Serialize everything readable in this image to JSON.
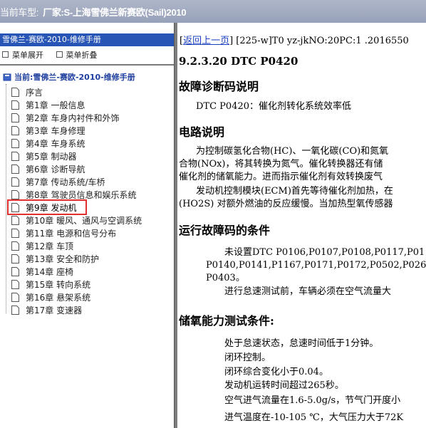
{
  "topbar": {
    "label": "当前车型:",
    "value": "厂家:S-上海雪佛兰新赛欧(Sail)2010"
  },
  "left": {
    "header": "雪佛兰-赛欧-2010-维修手册",
    "expand": "菜单展开",
    "collapse": "菜单折叠",
    "root": "当前:雪佛兰-赛欧-2010-维修手册",
    "items": [
      "序言",
      "第1章 一般信息",
      "第2章 车身内衬件和外饰",
      "第3章 车身修理",
      "第4章 车身系统",
      "第5章 制动器",
      "第6章 诊断导航",
      "第7章 传动系统/车桥",
      "第8章 驾驶员信息和娱乐系统",
      "第9章 发动机",
      "第10章 暖风、通风与空调系统",
      "第11章 电源和信号分布",
      "第12章 车顶",
      "第13章 安全和防护",
      "第14章 座椅",
      "第15章 转向系统",
      "第16章 悬架系统",
      "第17章 变速器"
    ]
  },
  "right": {
    "nav_open": "[",
    "nav_link": "返回上一页",
    "nav_rest": "] [225-w]T0 yz-jkNO:20PC:1 .2016550",
    "title": "9.2.3.20 DTC P0420",
    "sec1": "故障诊断码说明",
    "sec1_text": "DTC P0420：催化剂转化系统效率低",
    "sec2": "电路说明",
    "sec2_l1": "为控制碳氢化合物(HC)、一氧化碳(CO)和氮氧",
    "sec2_l2": "合物(NOx)，将其转换为氮气。催化转换器还有储",
    "sec2_l3": "催化剂的储氧能力。进而指示催化剂有效转换废气",
    "sec2_l4": "发动机控制模块(ECM)首先等待催化剂加热，在",
    "sec2_l5": "(HO2S) 对额外燃油的反应缓慢。当加热型氧传感器",
    "sec3": "运行故障码的条件",
    "sec3_l1": "未设置DTC P0106,P0107,P0108,P0117,P01",
    "sec3_l2": "P0140,P0141,P1167,P0171,P0172,P0502,P0261",
    "sec3_l3": "P0403。",
    "sec3_l4": "进行怠速测试前，车辆必须在空气流量大",
    "sec4": "储氧能力测试条件:",
    "sec4_l1": "处于怠速状态，怠速时间低于1分钟。",
    "sec4_l2": "闭环控制。",
    "sec4_l3": "闭环综合变化小于0.04。",
    "sec4_l4": "发动机运转时间超过265秒。",
    "sec4_l5": "空气进气流量在1.6-5.0g/s，节气门开度小",
    "sec4_l6": "进气温度在-10-105 ℃，大气压力大于72K"
  }
}
